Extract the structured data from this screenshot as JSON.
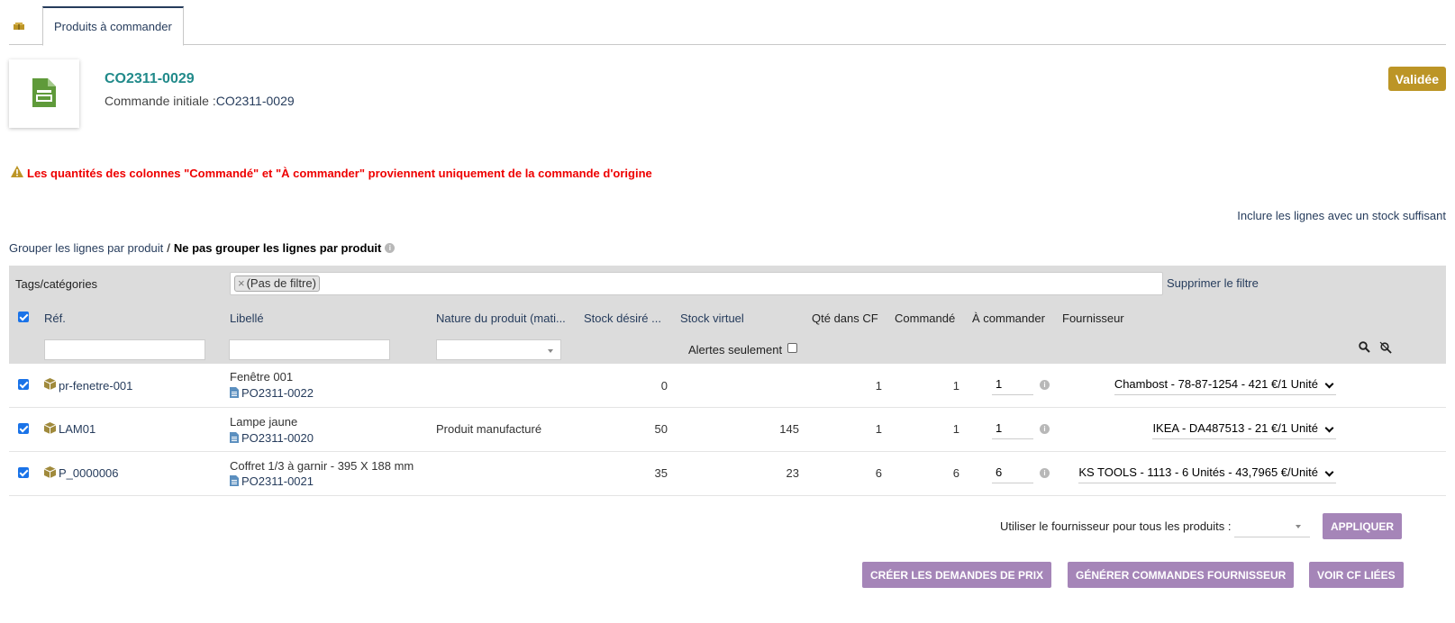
{
  "tabs": {
    "active": "Produits à commander"
  },
  "header": {
    "ref": "CO2311-0029",
    "initial_label": "Commande initiale :",
    "initial_ref": "CO2311-0029",
    "status": "Validée"
  },
  "warning": "Les quantités des colonnes \"Commandé\" et \"À commander\" proviennent uniquement de la commande d'origine",
  "include_link": "Inclure les lignes avec un stock suffisant",
  "grouping": {
    "group_link": "Grouper les lignes par produit",
    "separator": "/",
    "no_group": "Ne pas grouper les lignes par produit"
  },
  "filter": {
    "label": "Tags/catégories",
    "chip": "(Pas de filtre)",
    "chip_close": "×",
    "remove": "Supprimer le filtre"
  },
  "columns": {
    "ref": "Réf.",
    "label": "Libellé",
    "nature": "Nature du produit (mati...",
    "stock_desired": "Stock désiré ...",
    "stock_virtual": "Stock virtuel",
    "qty_cf": "Qté dans CF",
    "ordered": "Commandé",
    "to_order": "À commander",
    "supplier": "Fournisseur",
    "alerts_only": "Alertes seulement"
  },
  "rows": [
    {
      "ref": "pr-fenetre-001",
      "label": "Fenêtre 001",
      "po": "PO2311-0022",
      "nature": "",
      "stock_desired": "0",
      "stock_virtual": "",
      "qty_cf": "1",
      "ordered": "1",
      "to_order": "1",
      "supplier": "Chambost - 78-87-1254 - 421 €/1 Unité"
    },
    {
      "ref": "LAM01",
      "label": "Lampe jaune",
      "po": "PO2311-0020",
      "nature": "Produit manufacturé",
      "stock_desired": "50",
      "stock_virtual": "145",
      "qty_cf": "1",
      "ordered": "1",
      "to_order": "1",
      "supplier": "IKEA - DA487513 - 21 €/1 Unité"
    },
    {
      "ref": "P_0000006",
      "label": "Coffret 1/3 à garnir - 395 X 188 mm",
      "po": "PO2311-0021",
      "nature": "",
      "stock_desired": "35",
      "stock_virtual": "23",
      "qty_cf": "6",
      "ordered": "6",
      "to_order": "6",
      "supplier": "KS TOOLS - 1113 - 6 Unités - 43,7965 €/Unité"
    }
  ],
  "footer": {
    "apply_label": "Utiliser le fournisseur pour tous les produits :",
    "apply_button": "APPLIQUER",
    "btn_price_requests": "CRÉER LES DEMANDES DE PRIX",
    "btn_generate": "GÉNÉRER COMMANDES FOURNISSEUR",
    "btn_view": "VOIR CF LIÉES"
  },
  "colors": {
    "accent": "#263c5c",
    "teal": "#218a8a",
    "status": "#bc9526",
    "warning": "#ee0000",
    "button": "#a585b8"
  },
  "icons": [
    "box-icon",
    "document-icon",
    "warning-icon",
    "info-icon",
    "search-icon",
    "clear-filter-icon",
    "product-icon",
    "order-icon"
  ]
}
